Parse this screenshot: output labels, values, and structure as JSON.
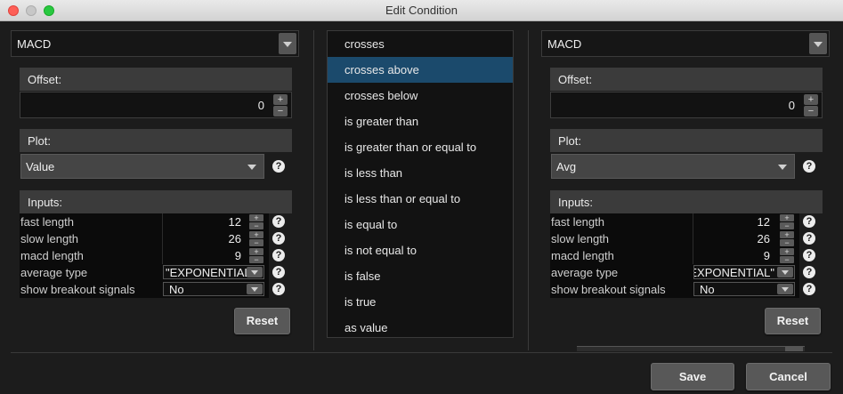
{
  "window": {
    "title": "Edit Condition"
  },
  "left": {
    "study": "MACD",
    "offset_label": "Offset:",
    "offset_value": "0",
    "plot_label": "Plot:",
    "plot_value": "Value",
    "inputs_label": "Inputs:",
    "inputs": [
      {
        "name": "fast length",
        "value": "12"
      },
      {
        "name": "slow length",
        "value": "26"
      },
      {
        "name": "macd length",
        "value": "9"
      },
      {
        "name": "average type",
        "value": "\"EXPONENTIAL\""
      },
      {
        "name": "show breakout signals",
        "value": "No"
      }
    ],
    "reset_label": "Reset"
  },
  "operators": {
    "items": [
      "crosses",
      "crosses above",
      "crosses below",
      "is greater than",
      "is greater than or equal to",
      "is less than",
      "is less than or equal to",
      "is equal to",
      "is not equal to",
      "is false",
      "is true",
      "as value"
    ],
    "selected": "crosses above",
    "selected_color": "#1b4a6c"
  },
  "right": {
    "study": "MACD",
    "offset_label": "Offset:",
    "offset_value": "0",
    "plot_label": "Plot:",
    "plot_value": "Avg",
    "inputs_label": "Inputs:",
    "inputs": [
      {
        "name": "fast length",
        "value": "12"
      },
      {
        "name": "slow length",
        "value": "26"
      },
      {
        "name": "macd length",
        "value": "9"
      },
      {
        "name": "average type",
        "value": "\"EXPONENTIAL\""
      },
      {
        "name": "show breakout signals",
        "value": "No"
      }
    ],
    "reset_label": "Reset"
  },
  "footer": {
    "save_label": "Save",
    "cancel_label": "Cancel"
  },
  "icons": {
    "help": "question-mark-icon",
    "spin_up": "plus-icon",
    "spin_down": "minus-icon",
    "dropdown": "chevron-down-icon"
  }
}
